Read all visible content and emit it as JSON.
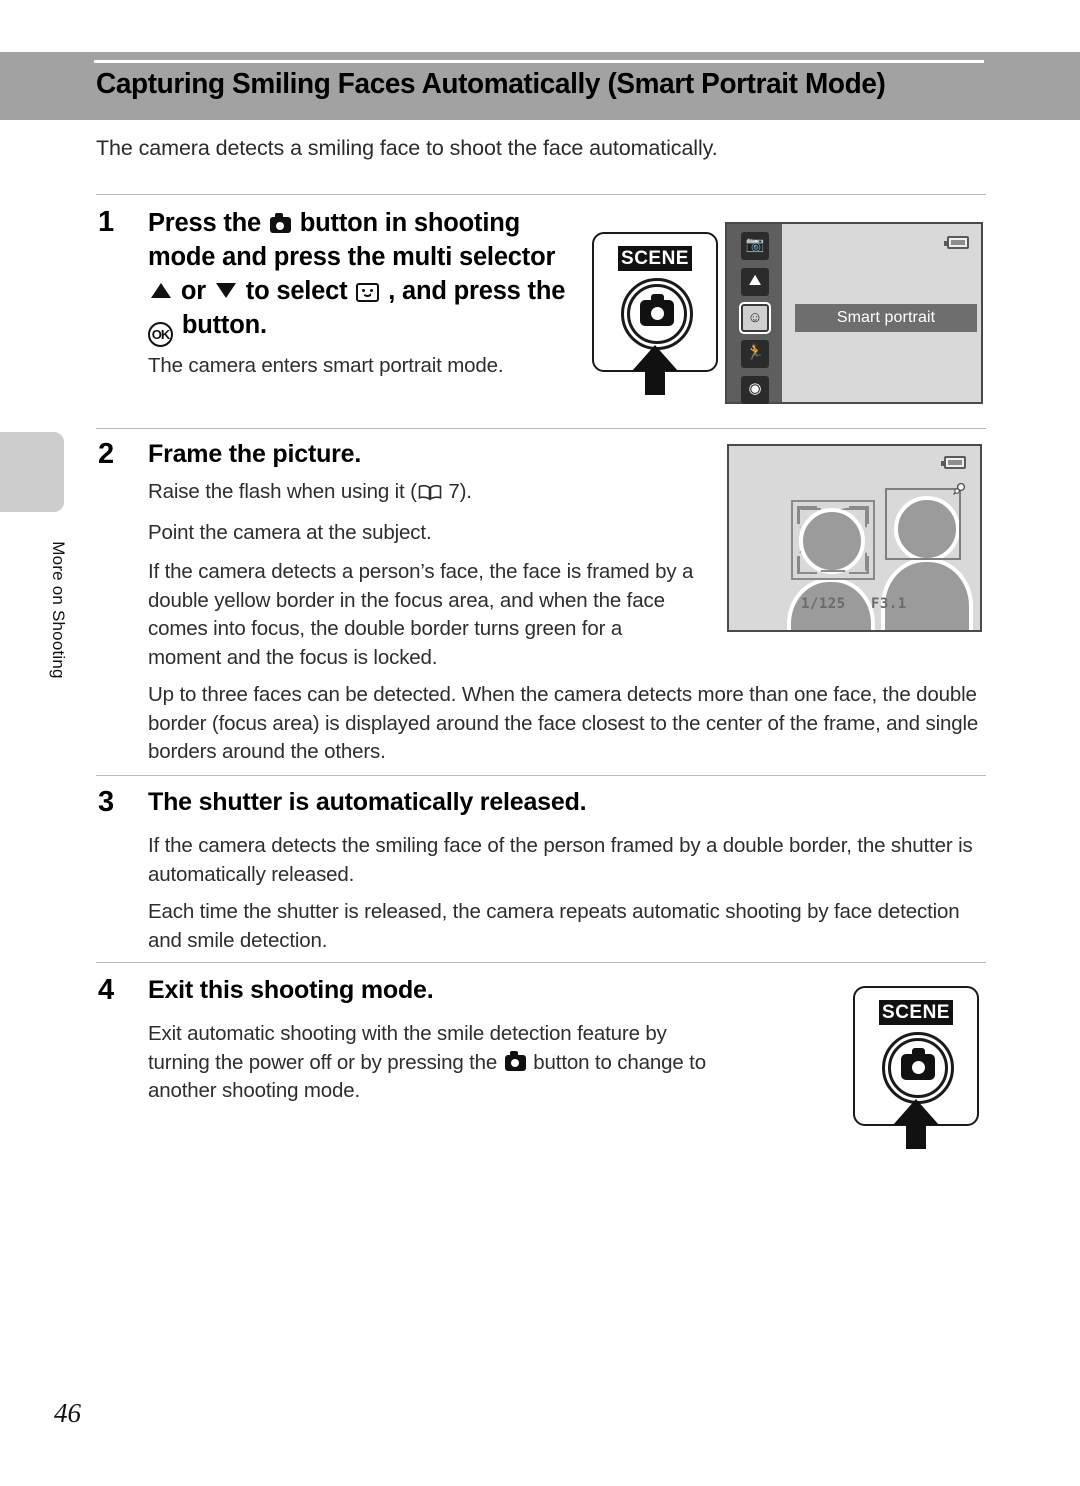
{
  "page": {
    "number": "46",
    "side_tab_label": "More on Shooting",
    "title": "Capturing Smiling Faces Automatically (Smart Portrait Mode)",
    "intro": "The camera detects a smiling face to shoot the face automatically."
  },
  "colors": {
    "banner_gray": "#a2a2a2",
    "side_tab_gray": "#cdcdcd",
    "rule_gray": "#b7b7b7",
    "lcd_bg": "#d9d9d9",
    "lcd_sidebar": "#5e5e5e",
    "silhouette": "#9b9b9b"
  },
  "steps": [
    {
      "number": "1",
      "heading_parts": {
        "a": "Press the",
        "b": "button in shooting mode and press the multi selector",
        "c": "or",
        "d": "to select",
        "e": ", and press the",
        "f": "button."
      },
      "body": "The camera enters smart portrait mode."
    },
    {
      "number": "2",
      "heading": "Frame the picture.",
      "body_lines": [
        "Raise the flash when using it (",
        "7).",
        "Point the camera at the subject.",
        "If the camera detects a person’s face, the face is framed by a double yellow border in the focus area, and when the face comes into focus, the double border turns green for a moment and the focus is locked.",
        "Up to three faces can be detected. When the camera detects more than one face, the double border (focus area) is displayed around the face closest to the center of the frame, and single borders around the others."
      ],
      "page_ref": "7"
    },
    {
      "number": "3",
      "heading": "The shutter is automatically released.",
      "body_lines": [
        "If the camera detects the smiling face of the person framed by a double border, the shutter is automatically released.",
        "Each time the shutter is released, the camera repeats automatic shooting by face detection and smile detection."
      ]
    },
    {
      "number": "4",
      "heading": "Exit this shooting mode.",
      "body_parts": {
        "a": "Exit automatic shooting with the smile detection feature by turning the power off or by pressing the",
        "b": "button to change to another shooting mode."
      }
    }
  ],
  "illustrations": {
    "scene_button": {
      "label": "SCENE",
      "icon": "camera-mode-icon",
      "arrow": "up-arrow-icon"
    },
    "lcd_menu": {
      "selected_item": "Smart portrait",
      "mode_icons": [
        "night-portrait-icon",
        "night-landscape-icon",
        "smart-portrait-icon",
        "sports-icon",
        "auto-mode-icon"
      ],
      "selected_index": 2,
      "battery": "battery-icon"
    },
    "viewfinder": {
      "shutter_speed": "1/125",
      "aperture": "F3.1",
      "battery": "battery-icon",
      "flash": "flash-ready-icon",
      "focus_double_label": "double-focus-border",
      "focus_single_label": "single-focus-border"
    }
  }
}
